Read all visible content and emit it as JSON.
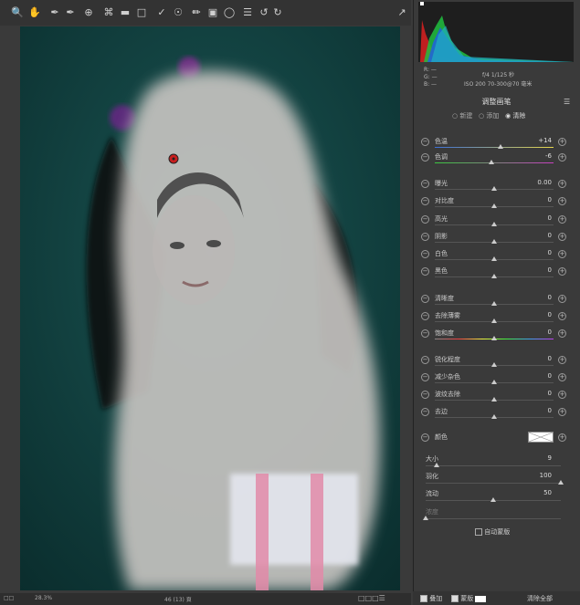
{
  "toolbar": {
    "tools": [
      "zoom-icon",
      "hand-icon",
      "white-balance-icon",
      "color-sampler-icon",
      "target-adjust-icon",
      "crop-icon",
      "straighten-icon",
      "transform-icon",
      "spot-removal-icon",
      "redeye-icon",
      "adjustment-brush-icon",
      "graduated-filter-icon",
      "radial-filter-icon",
      "preset-list-icon",
      "rotate-left-icon",
      "rotate-right-icon"
    ],
    "export_icon": "export-icon"
  },
  "status": {
    "zoom": "28.3%",
    "info": "46 (13) 頁"
  },
  "exif": {
    "rgb_r": "R:  —",
    "rgb_g": "G:  —",
    "rgb_b": "B:  —",
    "line1": "f/4   1/125 秒",
    "line2": "ISO 200   70-300@70 毫米"
  },
  "panel": {
    "title": "调整画笔",
    "mode_new": "新建",
    "mode_add": "添加",
    "mode_erase": "清除",
    "sliders": [
      {
        "label": "色温",
        "value": "+14",
        "pos": 0.55,
        "hue": "temp"
      },
      {
        "label": "色调",
        "value": "-6",
        "pos": 0.48,
        "hue": "tint"
      },
      {
        "label": "曝光",
        "value": "0.00",
        "pos": 0.5
      },
      {
        "label": "对比度",
        "value": "0",
        "pos": 0.5
      },
      {
        "label": "高光",
        "value": "0",
        "pos": 0.5
      },
      {
        "label": "阴影",
        "value": "0",
        "pos": 0.5
      },
      {
        "label": "白色",
        "value": "0",
        "pos": 0.5
      },
      {
        "label": "黑色",
        "value": "0",
        "pos": 0.5
      },
      {
        "label": "清晰度",
        "value": "0",
        "pos": 0.5
      },
      {
        "label": "去除薄雾",
        "value": "0",
        "pos": 0.5
      },
      {
        "label": "饱和度",
        "value": "0",
        "pos": 0.5,
        "hue": "sat"
      },
      {
        "label": "锐化程度",
        "value": "0",
        "pos": 0.5
      },
      {
        "label": "减少杂色",
        "value": "0",
        "pos": 0.5
      },
      {
        "label": "波纹去除",
        "value": "0",
        "pos": 0.5
      },
      {
        "label": "去边",
        "value": "0",
        "pos": 0.5
      }
    ],
    "color_label": "颜色",
    "brush": [
      {
        "label": "大小",
        "value": "9",
        "pos": 0.08
      },
      {
        "label": "羽化",
        "value": "100",
        "pos": 1.0
      },
      {
        "label": "流动",
        "value": "50",
        "pos": 0.5
      },
      {
        "label": "浓度",
        "value": "",
        "pos": 0.0
      }
    ],
    "auto_mask": "自动蒙版",
    "overlay": "叠加",
    "mask": "蒙版",
    "clear_all": "清除全部"
  }
}
